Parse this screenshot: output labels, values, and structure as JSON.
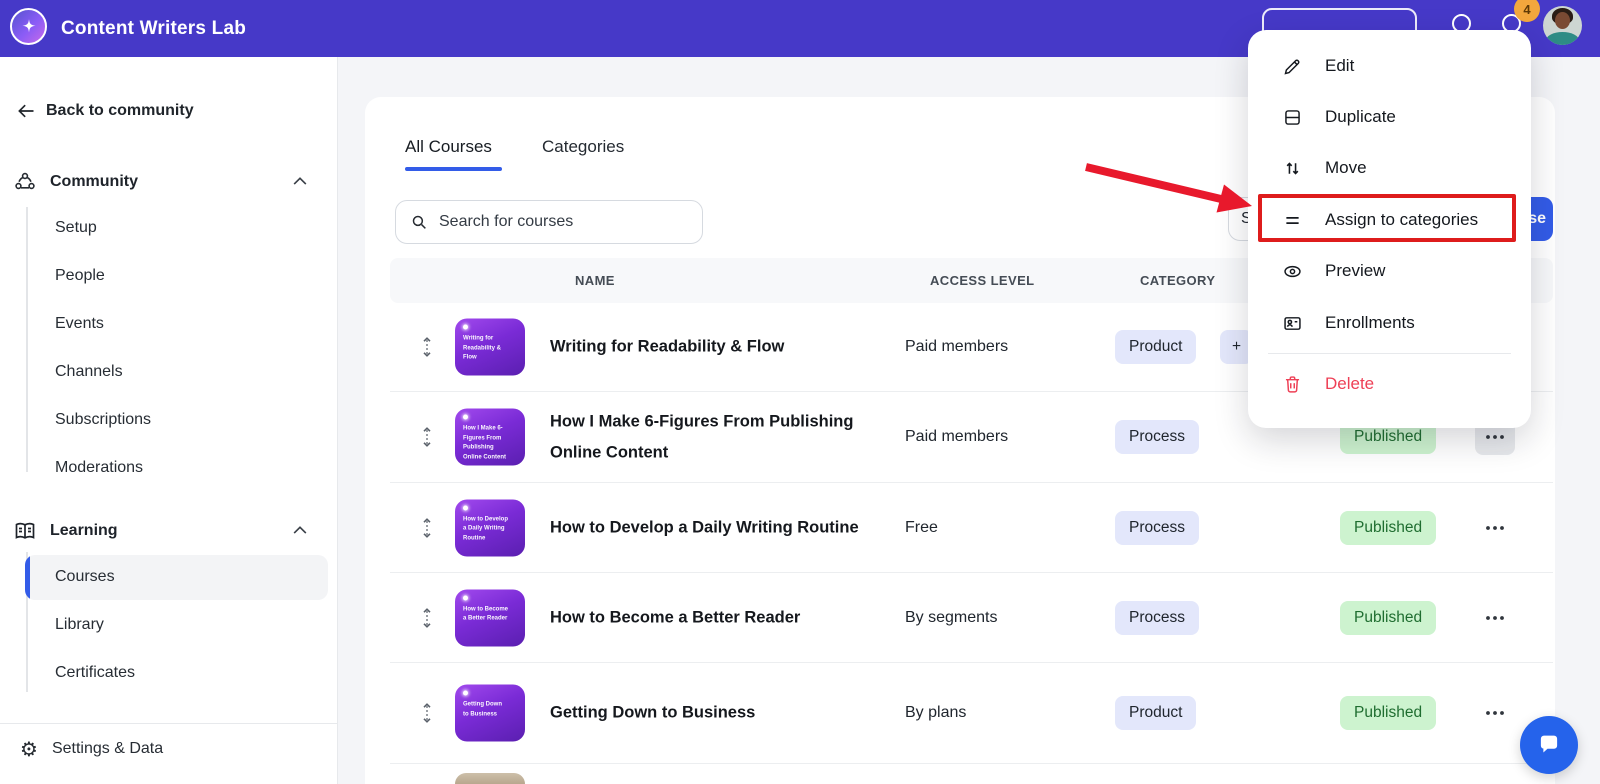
{
  "app": {
    "title": "Content Writers Lab"
  },
  "header": {
    "notification_badge": "4"
  },
  "sidebar": {
    "back_label": "Back to community",
    "community_section": {
      "label": "Community",
      "items": [
        "Setup",
        "People",
        "Events",
        "Channels",
        "Subscriptions",
        "Moderations"
      ]
    },
    "learning_section": {
      "label": "Learning",
      "items": [
        "Courses",
        "Library",
        "Certificates"
      ],
      "active_item": "Courses"
    },
    "settings_label": "Settings & Data"
  },
  "main": {
    "tabs": [
      "All Courses",
      "Categories"
    ],
    "active_tab": "All Courses",
    "search_placeholder": "Search for courses",
    "toolbar": {
      "partial_left_button_text": "S",
      "partial_primary_button_text": "se"
    },
    "table": {
      "columns": [
        "NAME",
        "ACCESS LEVEL",
        "CATEGORY"
      ],
      "rows": [
        {
          "name": "Writing for Readability & Flow",
          "access_level": "Paid members",
          "category": "Product",
          "extra_category_fragment": "+",
          "status": "",
          "menu_open": false
        },
        {
          "name": "How I Make 6-Figures From Publishing Online Content",
          "access_level": "Paid members",
          "category": "Process",
          "status": "Published",
          "menu_open": true
        },
        {
          "name": "How to Develop a Daily Writing Routine",
          "access_level": "Free",
          "category": "Process",
          "status": "Published",
          "menu_open": false
        },
        {
          "name": "How to Become a Better Reader",
          "access_level": "By segments",
          "category": "Process",
          "status": "Published",
          "menu_open": false
        },
        {
          "name": "Getting Down to Business",
          "access_level": "By plans",
          "category": "Product",
          "status": "Published",
          "menu_open": false
        }
      ]
    }
  },
  "context_menu": {
    "items": [
      {
        "label": "Edit",
        "icon": "pencil-icon",
        "danger": false,
        "highlighted": false
      },
      {
        "label": "Duplicate",
        "icon": "duplicate-icon",
        "danger": false,
        "highlighted": false
      },
      {
        "label": "Move",
        "icon": "move-icon",
        "danger": false,
        "highlighted": false
      },
      {
        "label": "Assign to categories",
        "icon": "assign-categories-icon",
        "danger": false,
        "highlighted": true
      },
      {
        "label": "Preview",
        "icon": "eye-icon",
        "danger": false,
        "highlighted": false
      },
      {
        "label": "Enrollments",
        "icon": "enrollments-icon",
        "danger": false,
        "highlighted": false
      },
      {
        "label": "Delete",
        "icon": "trash-icon",
        "danger": true,
        "highlighted": false
      }
    ]
  },
  "colors": {
    "header_bg": "#4639C8",
    "accent_blue": "#335CE8",
    "badge_orange": "#F3A73D",
    "category_pill_bg": "#E3E7FB",
    "status_published_bg": "#CDF3CF",
    "status_published_text": "#1F6D30",
    "danger_red": "#EE4056",
    "highlight_red": "#DE1C1C",
    "chat_blue": "#2563EB"
  }
}
